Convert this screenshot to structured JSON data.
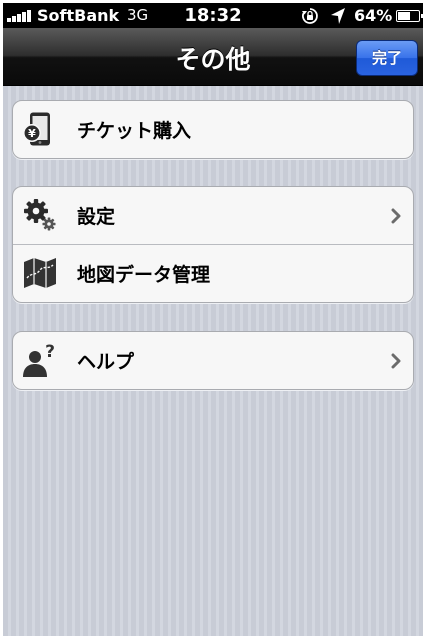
{
  "status_bar": {
    "carrier": "SoftBank",
    "network": "3G",
    "time": "18:32",
    "battery_percent": "64%",
    "battery_level": 0.64,
    "signal_bars": 5
  },
  "nav": {
    "title": "その他",
    "done_label": "完了"
  },
  "menu": {
    "ticket": {
      "label": "チケット購入",
      "icon": "phone-yen-icon"
    },
    "settings": {
      "label": "設定",
      "icon": "gears-icon"
    },
    "map_data": {
      "label": "地図データ管理",
      "icon": "map-icon"
    },
    "help": {
      "label": "ヘルプ",
      "icon": "person-question-icon"
    }
  },
  "colors": {
    "nav_background": "#1a1a1a",
    "done_button": "#2f6be6",
    "list_background": "#c8ccd6",
    "cell_background": "#f7f7f7"
  }
}
